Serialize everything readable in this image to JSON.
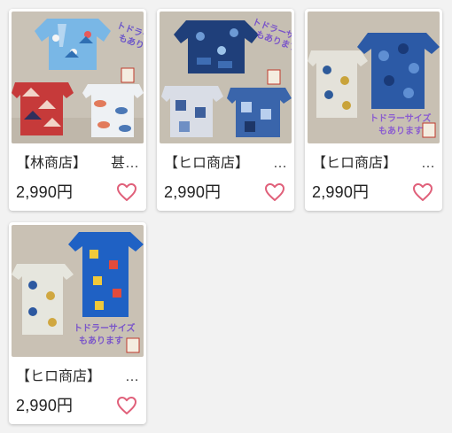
{
  "currency_suffix": "円",
  "accent_color": "#e0607a",
  "products": [
    {
      "title_shop": "【林商店】",
      "title_rest": "甚…",
      "price": "2,990円",
      "image_caption_lines": [
        "トドラーサイズ",
        "もあります"
      ],
      "heart_icon": "heart-outline-icon"
    },
    {
      "title_shop": "【ヒロ商店】",
      "title_rest": "…",
      "price": "2,990円",
      "image_caption_lines": [
        "トドラーサイズ",
        "もあります"
      ],
      "heart_icon": "heart-outline-icon"
    },
    {
      "title_shop": "【ヒロ商店】",
      "title_rest": "…",
      "price": "2,990円",
      "image_caption_lines": [
        "トドラーサイズ",
        "もあります"
      ],
      "heart_icon": "heart-outline-icon"
    },
    {
      "title_shop": "【ヒロ商店】",
      "title_rest": "…",
      "price": "2,990円",
      "image_caption_lines": [
        "トドラーサイズ",
        "もあります"
      ],
      "heart_icon": "heart-outline-icon"
    }
  ]
}
